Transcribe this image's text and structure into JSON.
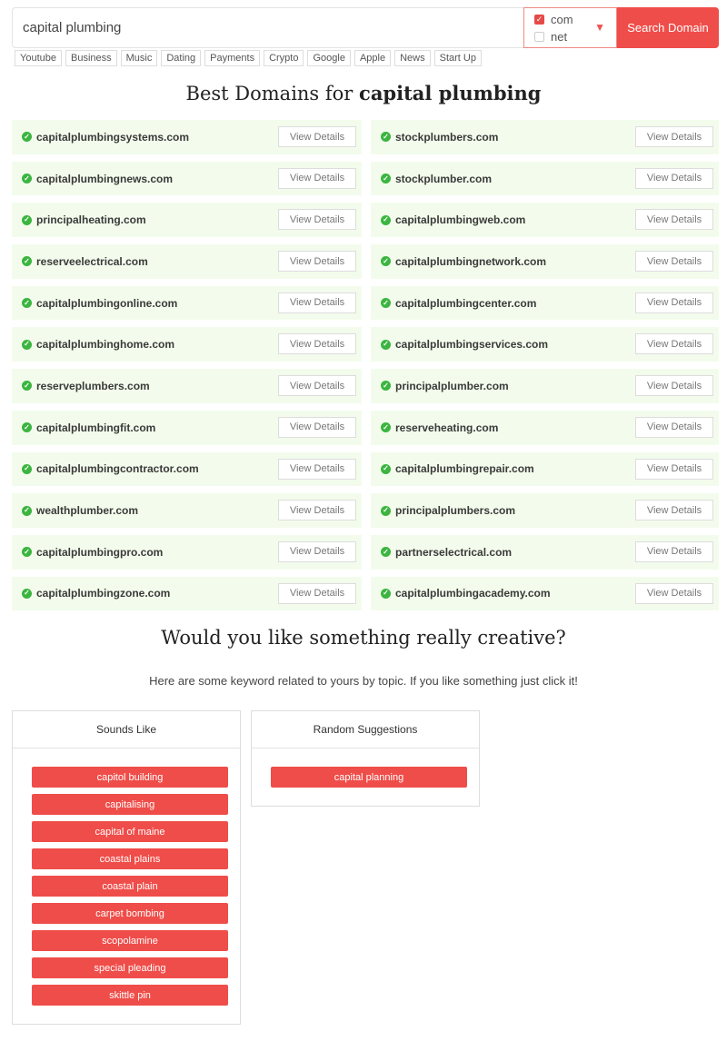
{
  "search": {
    "value": "capital plumbing",
    "button_label": "Search Domain"
  },
  "tlds": [
    {
      "label": "com",
      "checked": true
    },
    {
      "label": "net",
      "checked": false
    }
  ],
  "categories": [
    "Youtube",
    "Business",
    "Music",
    "Dating",
    "Payments",
    "Crypto",
    "Google",
    "Apple",
    "News",
    "Start Up"
  ],
  "results": {
    "title_prefix": "Best Domains for",
    "keyword": "capital plumbing",
    "view_label": "View Details",
    "domains": [
      "capitalplumbingsystems.com",
      "stockplumbers.com",
      "capitalplumbingnews.com",
      "stockplumber.com",
      "principalheating.com",
      "capitalplumbingweb.com",
      "reserveelectrical.com",
      "capitalplumbingnetwork.com",
      "capitalplumbingonline.com",
      "capitalplumbingcenter.com",
      "capitalplumbinghome.com",
      "capitalplumbingservices.com",
      "reserveplumbers.com",
      "principalplumber.com",
      "capitalplumbingfit.com",
      "reserveheating.com",
      "capitalplumbingcontractor.com",
      "capitalplumbingrepair.com",
      "wealthplumber.com",
      "principalplumbers.com",
      "capitalplumbingpro.com",
      "partnerselectrical.com",
      "capitalplumbingzone.com",
      "capitalplumbingacademy.com"
    ]
  },
  "creative": {
    "title": "Would you like something really creative?",
    "subtitle": "Here are some keyword related to yours by topic. If you like something just click it!"
  },
  "sounds_like": {
    "heading": "Sounds Like",
    "items": [
      "capitol building",
      "capitalising",
      "capital of maine",
      "coastal plains",
      "coastal plain",
      "carpet bombing",
      "scopolamine",
      "special pleading",
      "skittle pin"
    ]
  },
  "random": {
    "heading": "Random Suggestions",
    "items": [
      "capital planning"
    ]
  },
  "colors": {
    "accent": "#ef4d49",
    "row_bg": "#f3fcec",
    "check": "#3bb540"
  },
  "icons": {
    "check": "check-circle-icon",
    "dropdown": "dropdown-arrow-icon",
    "checkbox": "checkbox-icon"
  }
}
